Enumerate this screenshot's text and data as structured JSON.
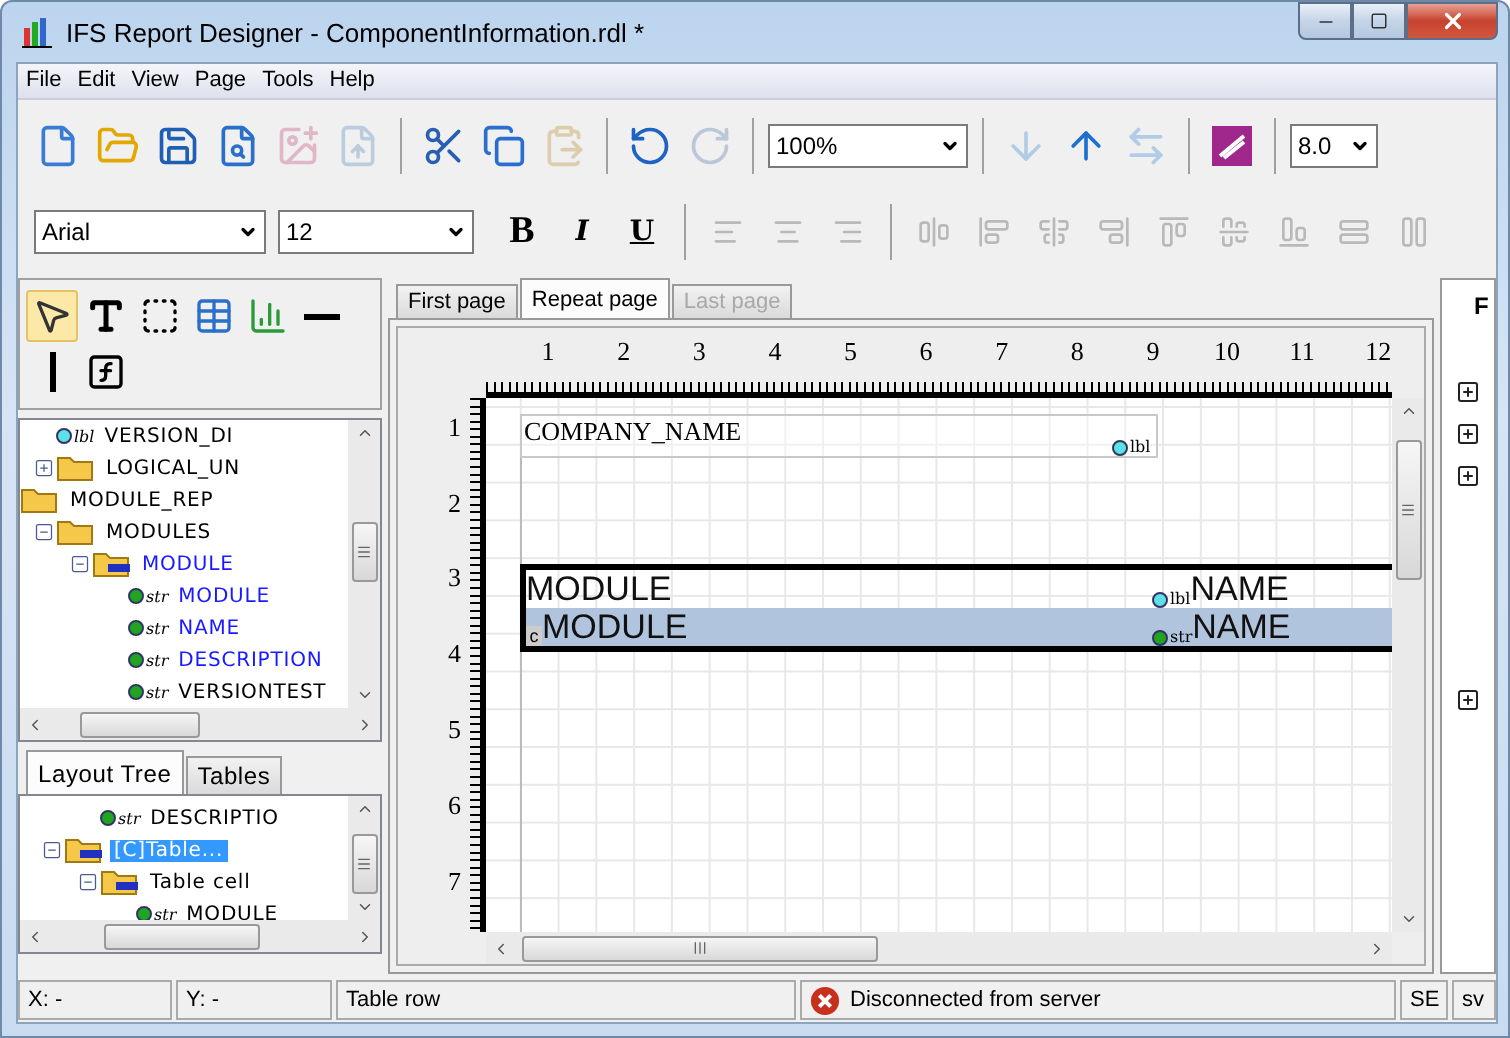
{
  "window": {
    "title": "IFS Report Designer - ComponentInformation.rdl *"
  },
  "menu": [
    "File",
    "Edit",
    "View",
    "Page",
    "Tools",
    "Help"
  ],
  "main_toolbar": {
    "buttons": [
      {
        "disabled": false
      },
      {
        "disabled": false
      },
      {
        "disabled": false
      },
      {
        "disabled": false
      },
      {
        "disabled": true
      },
      {
        "disabled": true
      },
      {
        "disabled": false
      },
      {
        "disabled": false
      },
      {
        "disabled": true
      },
      {
        "disabled": false
      },
      {
        "disabled": true
      },
      {
        "disabled": true
      },
      {
        "disabled": false
      },
      {
        "disabled": true
      },
      {
        "disabled": false
      }
    ],
    "zoom": "100%",
    "version": "8.0"
  },
  "format_toolbar": {
    "font": "Arial",
    "size": "12",
    "styles": [
      "B",
      "I",
      "U"
    ],
    "align_buttons": [
      {
        "disabled": true
      },
      {
        "disabled": true
      },
      {
        "disabled": true
      },
      {
        "disabled": true
      },
      {
        "disabled": true
      },
      {
        "disabled": true
      },
      {
        "disabled": true
      },
      {
        "disabled": true
      },
      {
        "disabled": true
      },
      {
        "disabled": true
      },
      {
        "disabled": true
      },
      {
        "disabled": true
      }
    ]
  },
  "palette": [
    {
      "selected": true
    },
    {
      "selected": false
    },
    {
      "selected": false
    },
    {
      "selected": false
    },
    {
      "selected": false
    },
    {
      "selected": false
    },
    {
      "selected": false
    },
    {
      "selected": false
    }
  ],
  "data_tree": [
    {
      "children": [
        {
          "label": "VERSION_DI",
          "kind": "label",
          "tag": "lbl",
          "bound": false,
          "selected": false
        },
        {
          "label": "LOGICAL_UN",
          "kind": "folder",
          "expanded": false,
          "bound": false,
          "selected": false
        }
      ]
    },
    {
      "label": "MODULE_REP",
      "kind": "folder",
      "bound": false,
      "selected": false,
      "children": [
        {
          "label": "MODULES",
          "kind": "folder",
          "expanded": true,
          "bound": false,
          "selected": false,
          "children": [
            {
              "label": "MODULE",
              "kind": "table",
              "expanded": true,
              "bound": true,
              "selected": false,
              "children": [
                {
                  "label": "MODULE",
                  "kind": "string",
                  "tag": "str",
                  "bound": true,
                  "selected": false
                },
                {
                  "label": "NAME",
                  "kind": "string",
                  "tag": "str",
                  "bound": true,
                  "selected": false
                },
                {
                  "label": "DESCRIPTION",
                  "kind": "string",
                  "tag": "str",
                  "bound": true,
                  "selected": false
                },
                {
                  "label": "VERSIONTEST",
                  "kind": "string",
                  "tag": "str",
                  "bound": false,
                  "selected": false
                }
              ]
            }
          ]
        }
      ]
    }
  ],
  "tree_tabs": [
    {
      "label": "Layout Tree",
      "selected": true
    },
    {
      "label": "Tables",
      "selected": false
    }
  ],
  "layout_tree": [
    {
      "children": [
        {
          "label": "DESCRIPTIO",
          "kind": "string",
          "tag": "str",
          "selected": false
        }
      ]
    },
    {
      "label": "[C]Table...",
      "kind": "table",
      "expanded": true,
      "selected": true,
      "children": [
        {
          "label": "Table cell",
          "kind": "table",
          "expanded": true,
          "selected": false,
          "children": [
            {
              "label": "MODULE",
              "kind": "string",
              "tag": "str",
              "selected": false
            }
          ]
        }
      ]
    }
  ],
  "page_tabs": [
    {
      "label": "First page",
      "selected": false,
      "disabled": false
    },
    {
      "label": "Repeat page",
      "selected": true,
      "disabled": false
    },
    {
      "label": "Last page",
      "selected": false,
      "disabled": true
    }
  ],
  "rulers": {
    "horizontal": [
      "1",
      "2",
      "3",
      "4",
      "5",
      "6",
      "7",
      "8",
      "9",
      "10",
      "11",
      "12"
    ],
    "vertical": [
      "1",
      "2",
      "3",
      "4",
      "5",
      "6",
      "7"
    ]
  },
  "canvas": {
    "label_field": {
      "text": "COMPANY_NAME",
      "tag": "lbl"
    },
    "table": {
      "marker": "c",
      "rows": [
        {
          "kind": "header",
          "selected": false,
          "cells": [
            "MODULE",
            "NAME"
          ],
          "tag": "lbl"
        },
        {
          "kind": "detail",
          "selected": true,
          "cells": [
            "MODULE",
            "NAME"
          ],
          "tag": "str"
        }
      ]
    }
  },
  "right_panel": {
    "heading": "F",
    "expanders": [
      {
        "expanded": false
      },
      {
        "expanded": false
      },
      {
        "expanded": false
      },
      {
        "expanded": false
      }
    ]
  },
  "status_bar": {
    "x": "X: -",
    "y": "Y: -",
    "selection": "Table row",
    "connection": "Disconnected from server",
    "connected": false,
    "locale": "SE",
    "language": "sv"
  }
}
